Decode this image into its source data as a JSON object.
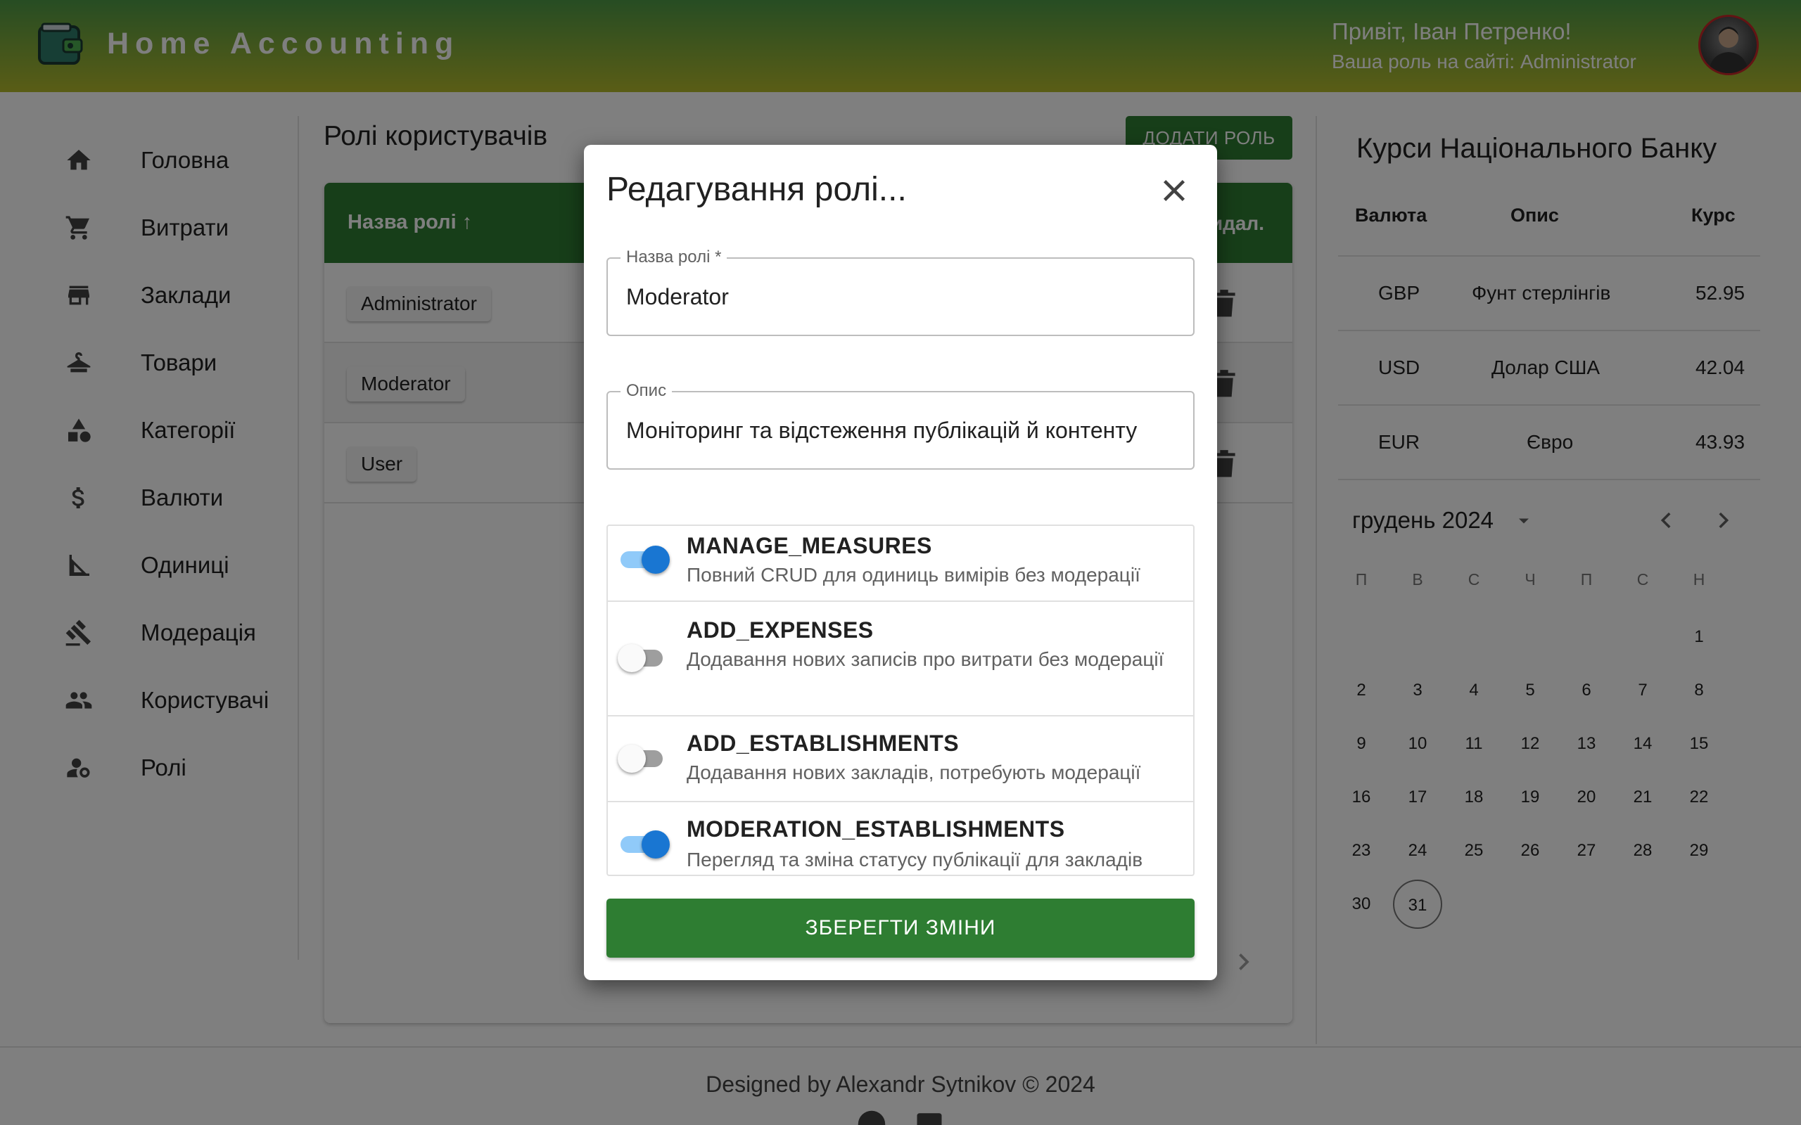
{
  "header": {
    "app_title": "Home Accounting",
    "greeting": "Привіт, Іван Петренко!",
    "role_text": "Ваша роль на сайті: Administrator"
  },
  "sidebar": {
    "items": [
      {
        "label": "Головна",
        "icon": "home-icon"
      },
      {
        "label": "Витрати",
        "icon": "cart-icon"
      },
      {
        "label": "Заклади",
        "icon": "store-icon"
      },
      {
        "label": "Товари",
        "icon": "hanger-icon"
      },
      {
        "label": "Категорії",
        "icon": "shapes-icon"
      },
      {
        "label": "Валюти",
        "icon": "dollar-icon"
      },
      {
        "label": "Одиниці",
        "icon": "measure-icon"
      },
      {
        "label": "Модерація",
        "icon": "gavel-icon"
      },
      {
        "label": "Користувачі",
        "icon": "users-icon"
      },
      {
        "label": "Ролі",
        "icon": "user-gear-icon"
      }
    ]
  },
  "main": {
    "title": "Ролі користувачів",
    "add_button": "ДОДАТИ РОЛЬ",
    "table": {
      "col_name": "Назва ролі ↑",
      "col_delete": "Видал.",
      "rows": [
        "Administrator",
        "Moderator",
        "User"
      ]
    }
  },
  "rates": {
    "title": "Курси Національного Банку",
    "headers": [
      "Валюта",
      "Опис",
      "Курс"
    ],
    "rows": [
      {
        "code": "GBP",
        "desc": "Фунт стерлінгів",
        "rate": "52.95"
      },
      {
        "code": "USD",
        "desc": "Долар США",
        "rate": "42.04"
      },
      {
        "code": "EUR",
        "desc": "Євро",
        "rate": "43.93"
      }
    ]
  },
  "calendar": {
    "month": "грудень 2024",
    "weekdays": [
      "П",
      "В",
      "С",
      "Ч",
      "П",
      "С",
      "Н"
    ],
    "first_weekday_index": 6,
    "days_in_month": 31,
    "today": 31
  },
  "footer": {
    "text": "Designed by Alexandr Sytnikov © 2024"
  },
  "modal": {
    "title": "Редагування ролі...",
    "name_label": "Назва ролі *",
    "name_value": "Moderator",
    "desc_label": "Опис",
    "desc_value": "Моніторинг та відстеження публікацій й контенту",
    "permissions": [
      {
        "name": "MANAGE_MEASURES",
        "desc": "Повний CRUD для одиниць вимірів без модерації",
        "enabled": true
      },
      {
        "name": "ADD_EXPENSES",
        "desc": "Додавання нових записів про витрати без модерації",
        "enabled": false
      },
      {
        "name": "ADD_ESTABLISHMENTS",
        "desc": "Додавання нових закладів, потребують модерації",
        "enabled": false
      },
      {
        "name": "MODERATION_ESTABLISHMENTS",
        "desc": "Перегляд та зміна статусу публікації для закладів",
        "enabled": true
      }
    ],
    "save_button": "ЗБЕРЕГТИ ЗМІНИ"
  },
  "colors": {
    "primary_green": "#2e7d32",
    "header_gradient_top": "#4e9a47",
    "header_gradient_bottom": "#b4ba2c",
    "switch_on": "#1976d2"
  }
}
